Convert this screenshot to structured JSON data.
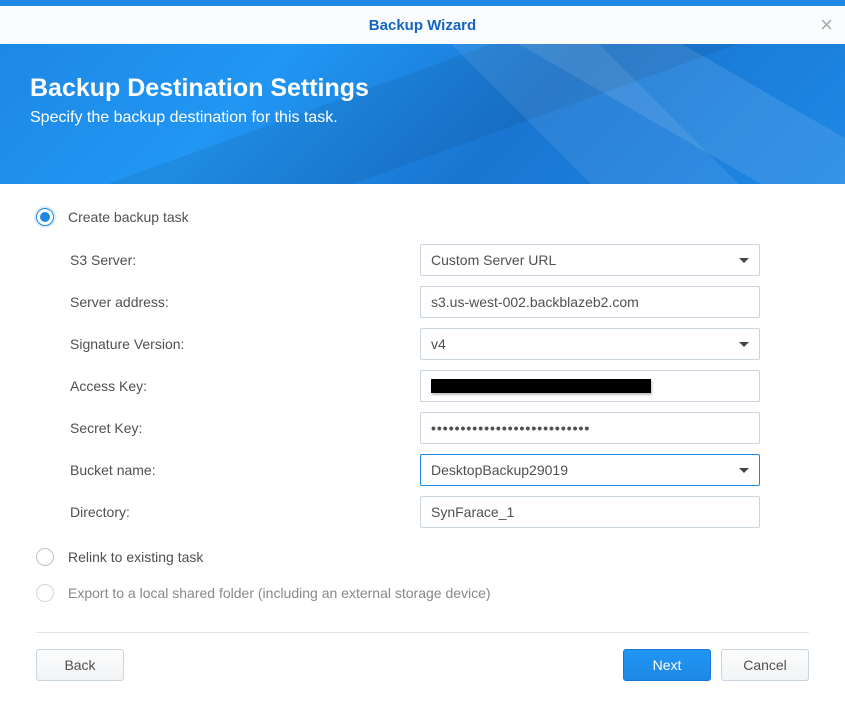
{
  "window": {
    "title": "Backup Wizard"
  },
  "banner": {
    "heading": "Backup Destination Settings",
    "subheading": "Specify the backup destination for this task."
  },
  "options": {
    "create": {
      "label": "Create backup task",
      "selected": true
    },
    "relink": {
      "label": "Relink to existing task",
      "selected": false
    },
    "export": {
      "label": "Export to a local shared folder (including an external storage device)",
      "selected": false
    }
  },
  "form": {
    "s3server": {
      "label": "S3 Server:",
      "value": "Custom Server URL"
    },
    "serverAddress": {
      "label": "Server address:",
      "value": "s3.us-west-002.backblazeb2.com"
    },
    "signature": {
      "label": "Signature Version:",
      "value": "v4"
    },
    "accessKey": {
      "label": "Access Key:"
    },
    "secretKey": {
      "label": "Secret Key:",
      "value": "•••••••••••••••••••••••••••"
    },
    "bucket": {
      "label": "Bucket name:",
      "value": "DesktopBackup29019"
    },
    "directory": {
      "label": "Directory:",
      "value": "SynFarace_1"
    }
  },
  "buttons": {
    "back": "Back",
    "next": "Next",
    "cancel": "Cancel"
  }
}
